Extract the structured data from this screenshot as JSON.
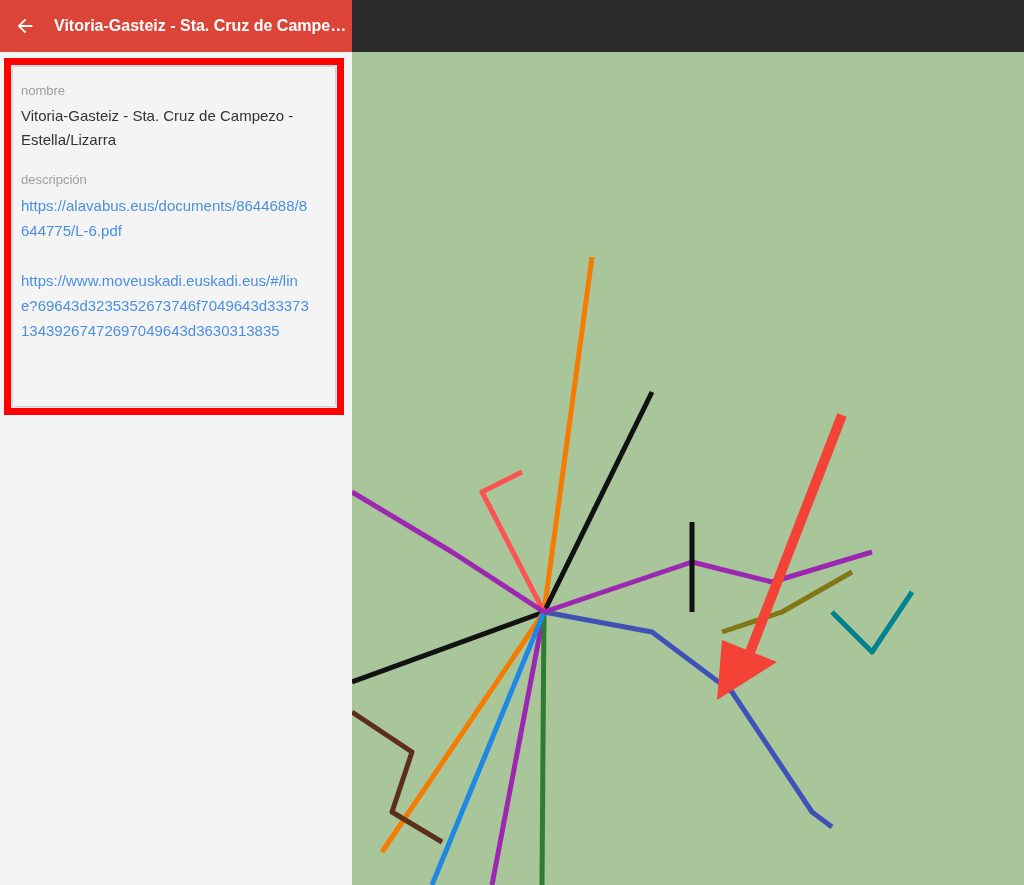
{
  "app_bar": {
    "title": "Vitoria-Gasteiz - Sta. Cruz de Campe…"
  },
  "details": [
    {
      "label": "nombre",
      "kind": "text",
      "values": [
        "Vitoria-Gasteiz - Sta. Cruz de Campezo - Estella/Lizarra"
      ]
    },
    {
      "label": "descripción",
      "kind": "links",
      "values": [
        "https://alavabus.eus/documents/8644688/8644775/L-6.pdf",
        "https://www.moveuskadi.euskadi.eus/#/line?69643d3235352673746f7049643d3337313439267472697049643d3630313835"
      ]
    }
  ]
}
